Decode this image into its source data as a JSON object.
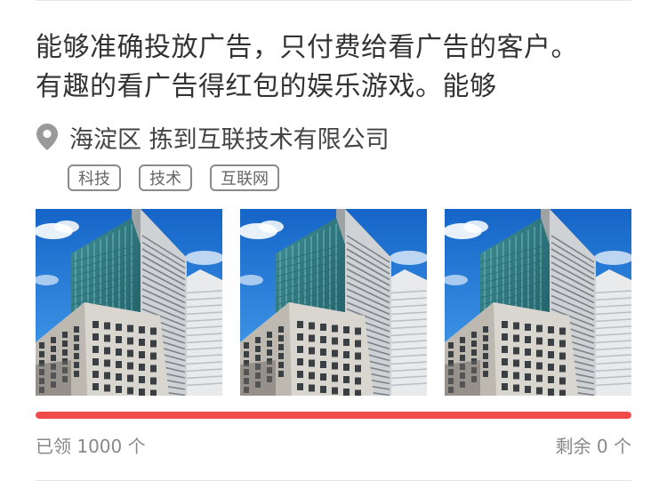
{
  "ad": {
    "title_line1": "能够准确投放广告，只付费给看广告的客户。",
    "title_line2": "有趣的看广告得红包的娱乐游戏。能够",
    "location_icon": "location-pin-icon",
    "location": "海淀区 拣到互联技术有限公司",
    "tags": [
      "科技",
      "技术",
      "互联网"
    ],
    "photos": [
      "office-building-photo",
      "office-building-photo",
      "office-building-photo"
    ],
    "claimed": "已领 1000 个",
    "remaining": "剩余 0 个",
    "progress_fraction": 1.0
  },
  "colors": {
    "title": "#333333",
    "location_icon": "#9a9a9a",
    "tag_border": "#8a8a8a",
    "progress_track": "#fbe9ea",
    "progress_fill": "#f04b4b",
    "stats_text": "#888888"
  }
}
